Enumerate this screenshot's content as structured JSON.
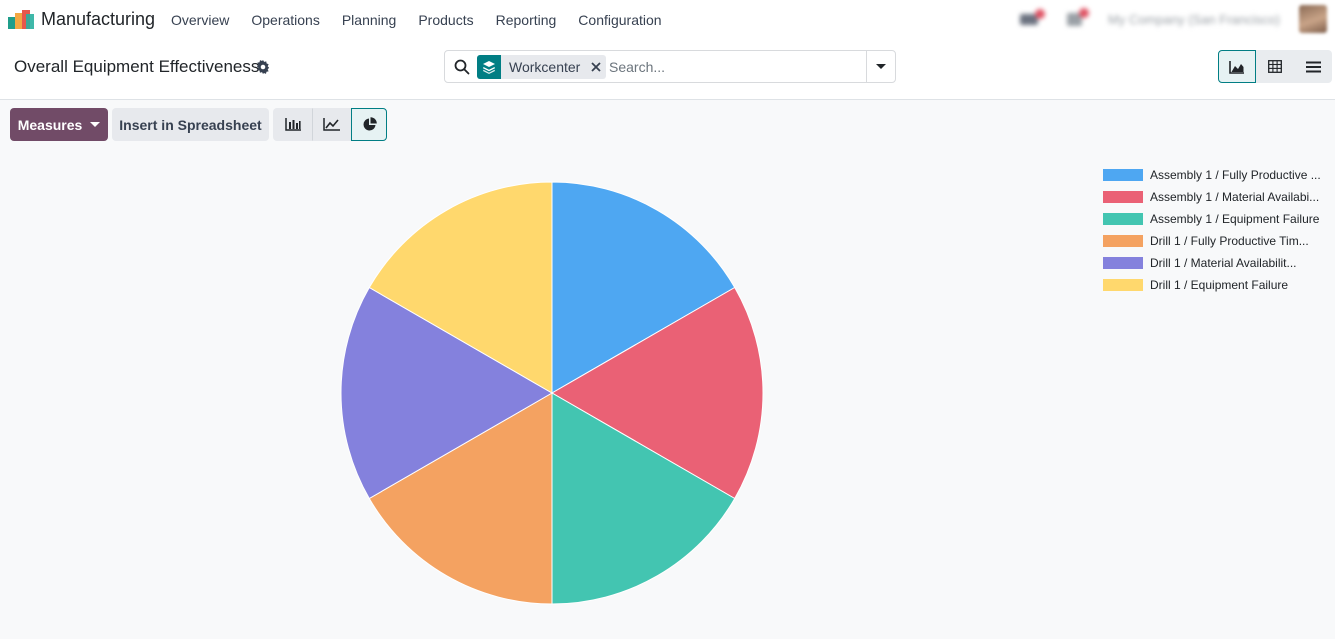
{
  "app": {
    "name": "Manufacturing"
  },
  "menu": [
    {
      "label": "Overview"
    },
    {
      "label": "Operations"
    },
    {
      "label": "Planning"
    },
    {
      "label": "Products"
    },
    {
      "label": "Reporting"
    },
    {
      "label": "Configuration"
    }
  ],
  "systray": {
    "company": "My Company (San Francisco)"
  },
  "page": {
    "title": "Overall Equipment Effectiveness"
  },
  "search": {
    "facet_label": "Workcenter",
    "placeholder": "Search..."
  },
  "toolbar": {
    "measures_label": "Measures",
    "spreadsheet_label": "Insert in Spreadsheet"
  },
  "colors": {
    "brand": "#714b67",
    "accent": "#017e84"
  },
  "chart_data": {
    "type": "pie",
    "legend_position": "top-right",
    "slices": [
      {
        "label": "Assembly 1 / Fully Productive ...",
        "value": 1,
        "color": "#4ea7f2"
      },
      {
        "label": "Assembly 1 / Material Availabi...",
        "value": 1,
        "color": "#ea6175"
      },
      {
        "label": "Assembly 1 / Equipment Failure",
        "value": 1,
        "color": "#43c5b1"
      },
      {
        "label": "Drill 1 / Fully Productive Tim...",
        "value": 1,
        "color": "#f4a261"
      },
      {
        "label": "Drill 1 / Material Availabilit...",
        "value": 1,
        "color": "#8481dd"
      },
      {
        "label": "Drill 1 / Equipment Failure",
        "value": 1,
        "color": "#ffd86d"
      }
    ]
  }
}
